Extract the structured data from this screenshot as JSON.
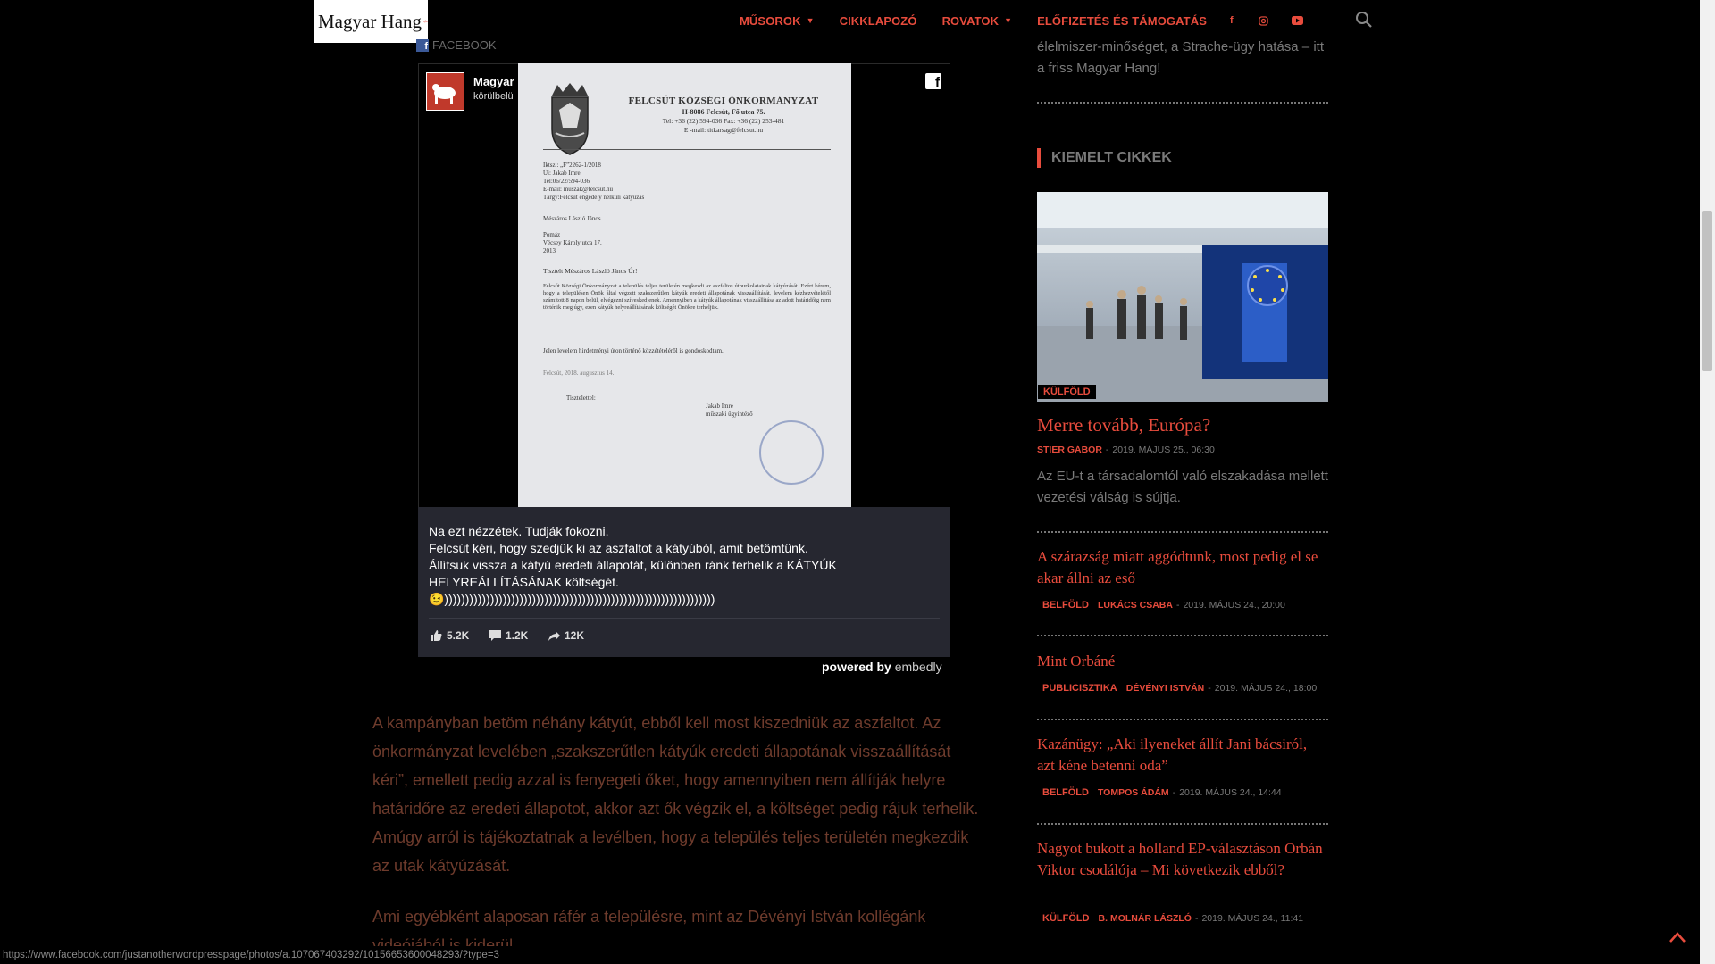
{
  "header": {
    "logo_text": "Magyar Hang",
    "nav": [
      {
        "label": "MŰSOROK",
        "dropdown": true
      },
      {
        "label": "CIKKLAPOZÓ",
        "dropdown": false
      },
      {
        "label": "ROVATOK",
        "dropdown": true
      },
      {
        "label": "ELŐFIZETÉS ÉS TÁMOGATÁS",
        "dropdown": false
      }
    ],
    "social": [
      "f",
      "instagram-icon",
      "youtube-icon"
    ],
    "accent": "#e84c3d"
  },
  "embed": {
    "source_label": "FACEBOOK",
    "page_name": "Magyar",
    "page_time": "körülbelü",
    "letter": {
      "org": "FELCSÚT KÖZSÉGI ÖNKORMÁNYZAT",
      "address": "H-8086 Felcsút, Fő utca 75.",
      "phone": "Tel: +36 (22) 594-036    Fax: +36 (22) 253-481",
      "email": "E -mail: titkarsag@felcsut.hu",
      "meta": "Iktsz.: „F”2262-1/2018\nÜi: Jakab Imre\nTel:06/22/594-036\nE-mail: muszak@felcsut.hu\nTárgy:Felcsút engedély nélküli kátyúzás",
      "addressee": "Mészáros László János\n\nPomáz\nVécsey Károly utca 17.\n2013",
      "greeting": "Tisztelt Mészáros László János Úr!",
      "body": "Felcsút Községi Önkormányzat a település teljes területén megkezdi az aszfaltos útburkolatainak kátyúzását. Ezért kérem, hogy a településen Önök által végzett szakszerűtlen kátyúk eredeti állapotának visszaállítását, levelem kézhezvételétől számított 8 napon belül, elvégezni szíveskedjenek. Amennyiben a kátyúk állapotának visszaállítása az adott határidőig nem történik meg úgy, ezen kátyúk helyreállításának költségét Önökre terheljük.",
      "body2": "Jelen levelem hirdetményi úton történő közzétételéről is gondoskodtam.",
      "date": "Felcsút, 2018. augusztus 14.",
      "regards": "Tisztelettel:",
      "signature": "Jakab Imre\nműszaki ügyintéző"
    },
    "post_text": "Na ezt nézzétek. Tudják fokozni.\nFelcsút kéri, hogy szedjük ki az aszfaltot a kátyúból, amit betömtünk.\nÁllítsuk vissza a kátyú eredeti állapotát, különben ránk terhelik a KÁTYÚK HELYREÁLLÍTÁSÁNAK költségét.\n😉)))))))))))))))))))))))))))))))))))))))))))))))))))))))))))))))))",
    "likes": "5.2K",
    "comments": "1.2K",
    "shares": "12K",
    "powered_by": "powered by",
    "powered_brand": "embedly"
  },
  "article": {
    "p1": "A kampányban betöm néhány kátyút, ebből kell most kiszedniük az aszfaltot. Az önkormányzat levelében „szakszerűtlen kátyúk eredeti állapotának visszaállítását kéri”, emellett pedig azzal is fenyegeti őket, hogy amennyiben nem állítják helyre határidőre az eredeti állapotot, akkor azt ők végzik el, a költséget pedig rájuk terhelik. Amúgy arról is tájékoztatnak a levélben, hogy a település teljes területén megkezdik az utak kátyúzását.",
    "p2": "Ami egyébként alaposan ráfér a településre, mint az Dévényi István kollégánk videójából is kiderül."
  },
  "sidebar": {
    "top_snippet": "élelmiszer-minőséget, a Strache-ügy hatása – itt a friss Magyar Hang!",
    "section_title": "KIEMELT CIKKEK",
    "featured": {
      "tag": "KÜLFÖLD",
      "title": "Merre tovább, Európa?",
      "author": "STIER GÁBOR",
      "date": "2019. MÁJUS 25., 06:30",
      "excerpt": "Az EU-t a társadalomtól való elszakadása mellett vezetési válság is sújtja."
    },
    "articles": [
      {
        "title": "A szárazság miatt aggódtunk, most pedig el se akar állni az eső",
        "tag": "BELFÖLD",
        "author": "LUKÁCS CSABA",
        "date": "2019. MÁJUS 24., 20:00"
      },
      {
        "title": "Mint Orbáné",
        "tag": "PUBLICISZTIKA",
        "author": "DÉVÉNYI ISTVÁN",
        "date": "2019. MÁJUS 24., 18:00"
      },
      {
        "title": "Kazánügy: „Aki ilyeneket állít Jani bácsiról, azt kéne betenni oda”",
        "tag": "BELFÖLD",
        "author": "TOMPOS ÁDÁM",
        "date": "2019. MÁJUS 24., 14:44"
      },
      {
        "title": "Nagyot bukott a holland EP-választáson Orbán Viktor csodálója – Mi következik ebből?",
        "tag": "KÜLFÖLD",
        "author": "B. MOLNÁR LÁSZLÓ",
        "date": "2019. MÁJUS 24., 11:41"
      }
    ]
  },
  "status_url": "https://www.facebook.com/justanotherwordpresspage/photos/a.107067403292/10156653600048293/?type=3"
}
